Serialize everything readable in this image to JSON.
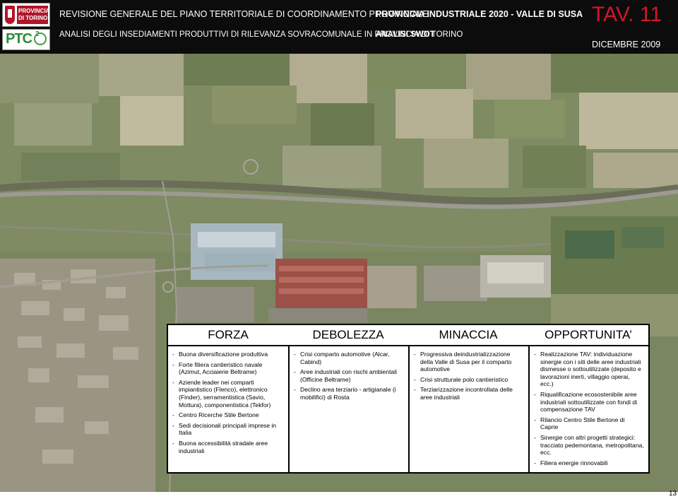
{
  "header": {
    "logo_top_line1": "PROVINCIA",
    "logo_top_line2": "DI TORINO",
    "logo_bottom_text": "PTC",
    "logo_bottom_sup": "2",
    "title_line1": "REVISIONE GENERALE DEL PIANO TERRITORIALE DI COORDINAMENTO PROVINCIALE",
    "title_line2": "ANALISI DEGLI INSEDIAMENTI PRODUTTIVI DI RILEVANZA SOVRACOMUNALE IN PROVINCIA DI TORINO",
    "area": "PROVINCIA INDUSTRIALE 2020 - VALLE DI SUSA",
    "section": "ANALISI SWOT",
    "table_id": "TAV. 11",
    "date": "DICEMBRE 2009"
  },
  "colors": {
    "header_bg": "#0c0c0c",
    "table_id_color": "#d3162b",
    "logo_red": "#b0162a",
    "logo_green": "#2e8a3a"
  },
  "swot": {
    "headers": [
      "FORZA",
      "DEBOLEZZA",
      "MINACCIA",
      "OPPORTUNITA’"
    ],
    "forza": [
      "Buona diversificazione produttiva",
      "Forte filiera cantieristico navale (Azimut, Acciaierie Beltrame)",
      "Aziende leader nei comparti impiantistico (Flenco), elettronico (Finder), serramentistica (Savio, Mottura), componentistica (Tekfor)",
      "Centro Ricerche Stile Bertone",
      "Sedi decisionali principali imprese in Italia",
      "Buona accessibilità stradale aree industriali"
    ],
    "debolezza": [
      "Crisi comparto automotive (Alcar, Cabind)",
      "Aree industriali con rischi ambientali (Officine Beltrame)",
      "Declino area terziario - artigianale (i mobilifici) di Rosta"
    ],
    "minaccia": [
      "Progressiva deindustrializzazione della Valle di Susa per il comparto automotive",
      "Crisi strutturale polo cantieristico",
      "Terziarizzazione incontrollata delle aree industriali"
    ],
    "opportunita": [
      "Realizzazione TAV: individuazione sinergie con i siti delle aree industriali dismesse o sottoutilizzate (deposito e lavorazioni inerti, villaggio operai, ecc.)",
      "Riqualificazione ecosostenibile aree industriali sottoutilizzate con fondi di compensazione TAV",
      "Rilancio Centro Stile Bertone di Caprie",
      "Sinergie con altri progetti strategici: tracciato pedemontana, metropolitana, ecc.",
      "Filiera energie rinnovabili"
    ]
  },
  "page_number": "13"
}
